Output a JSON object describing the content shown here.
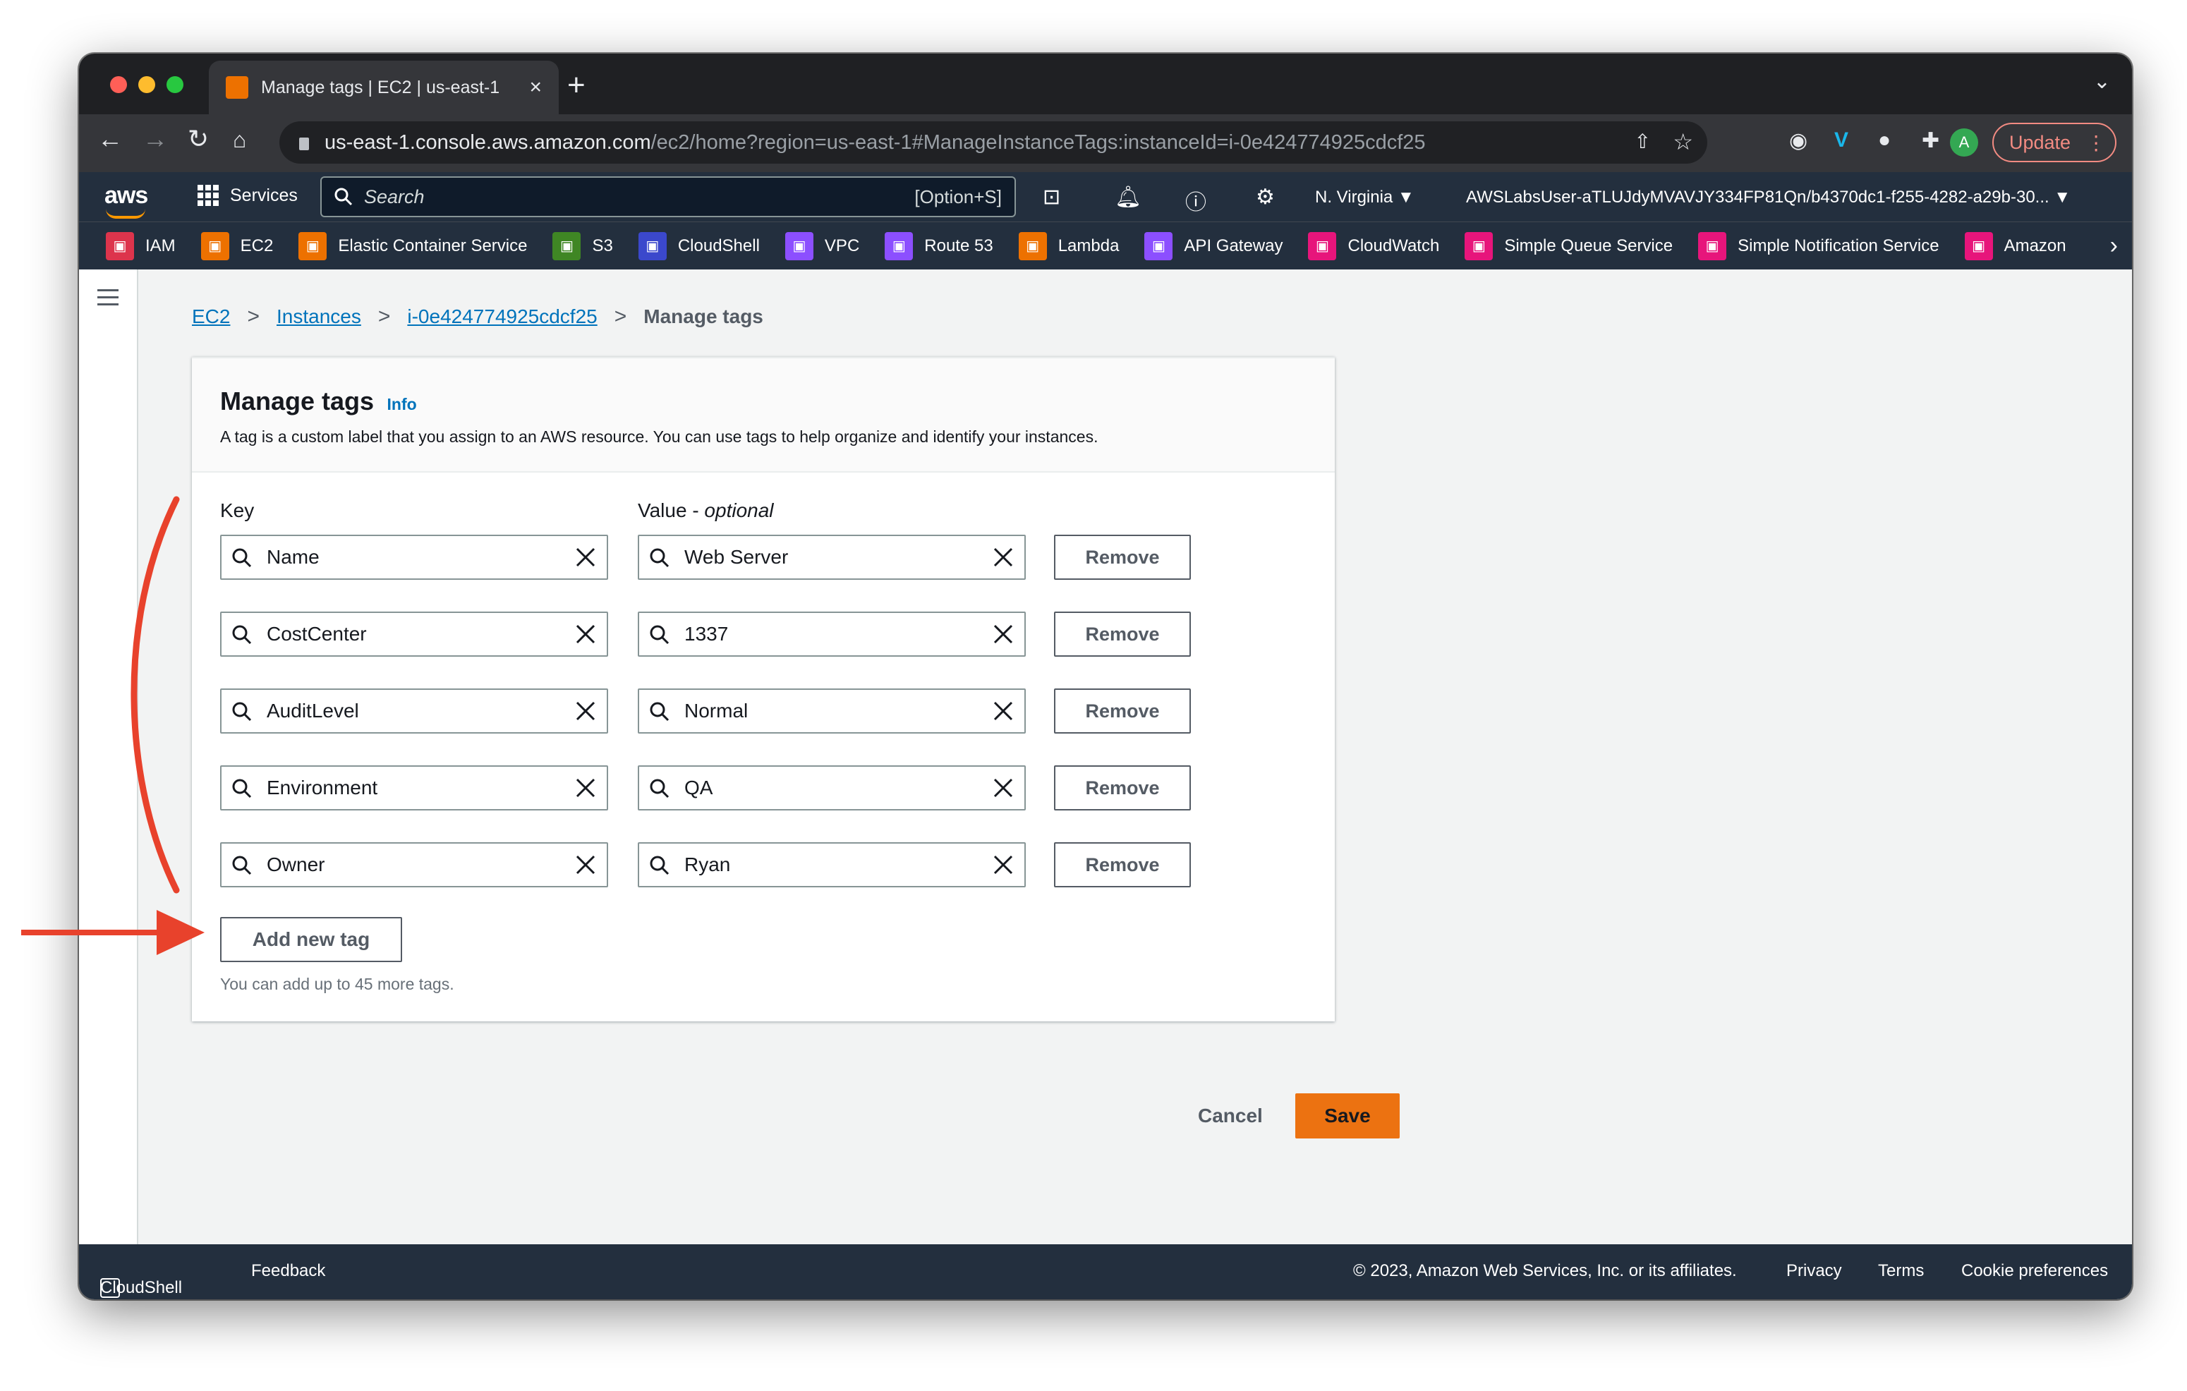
{
  "browser": {
    "tab_title": "Manage tags | EC2 | us-east-1",
    "url_host": "us-east-1.console.aws.amazon.com",
    "url_path": "/ec2/home?region=us-east-1#ManageInstanceTags:instanceId=i-0e424774925cdcf25",
    "profile_initial": "A",
    "update_label": "Update"
  },
  "aws_header": {
    "logo": "aws",
    "services_label": "Services",
    "search_placeholder": "Search",
    "search_shortcut": "[Option+S]",
    "region": "N. Virginia ▼",
    "account": "AWSLabsUser-aTLUJdyMVAVJY334FP81Qn/b4370dc1-f255-4282-a29b-30... ▼"
  },
  "favorites": [
    {
      "label": "IAM",
      "color": "#dd344c"
    },
    {
      "label": "EC2",
      "color": "#ed7100"
    },
    {
      "label": "Elastic Container Service",
      "color": "#ed7100"
    },
    {
      "label": "S3",
      "color": "#3f8624"
    },
    {
      "label": "CloudShell",
      "color": "#3b48cc"
    },
    {
      "label": "VPC",
      "color": "#8c4fff"
    },
    {
      "label": "Route 53",
      "color": "#8c4fff"
    },
    {
      "label": "Lambda",
      "color": "#ed7100"
    },
    {
      "label": "API Gateway",
      "color": "#8c4fff"
    },
    {
      "label": "CloudWatch",
      "color": "#e7157b"
    },
    {
      "label": "Simple Queue Service",
      "color": "#e7157b"
    },
    {
      "label": "Simple Notification Service",
      "color": "#e7157b"
    },
    {
      "label": "Amazon",
      "color": "#e7157b"
    }
  ],
  "breadcrumb": {
    "items": [
      "EC2",
      "Instances",
      "i-0e424774925cdcf25"
    ],
    "current": "Manage tags"
  },
  "panel": {
    "title": "Manage tags",
    "info": "Info",
    "description": "A tag is a custom label that you assign to an AWS resource. You can use tags to help organize and identify your instances.",
    "key_label": "Key",
    "value_label": "Value - ",
    "value_label_optional": "optional",
    "remove_label": "Remove",
    "add_label": "Add new tag",
    "limit_note": "You can add up to 45 more tags.",
    "tags": [
      {
        "key": "Name",
        "value": "Web Server"
      },
      {
        "key": "CostCenter",
        "value": "1337"
      },
      {
        "key": "AuditLevel",
        "value": "Normal"
      },
      {
        "key": "Environment",
        "value": "QA"
      },
      {
        "key": "Owner",
        "value": "Ryan"
      }
    ]
  },
  "actions": {
    "cancel": "Cancel",
    "save": "Save"
  },
  "footer": {
    "cloudshell": "CloudShell",
    "feedback": "Feedback",
    "copyright": "© 2023, Amazon Web Services, Inc. or its affiliates.",
    "privacy": "Privacy",
    "terms": "Terms",
    "cookies": "Cookie preferences"
  },
  "colors": {
    "accent": "#ec7211",
    "link": "#0073bb",
    "annotation": "#e8422c"
  }
}
